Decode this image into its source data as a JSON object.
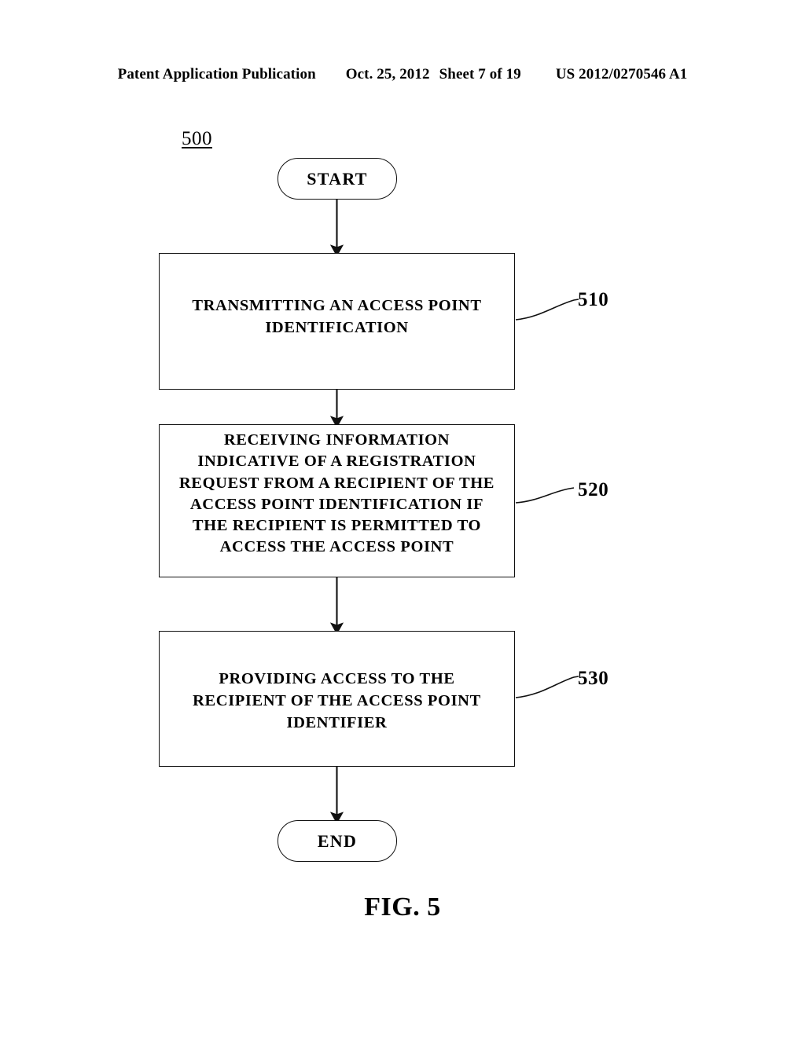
{
  "header": {
    "publication": "Patent Application Publication",
    "date": "Oct. 25, 2012",
    "sheet": "Sheet 7 of 19",
    "patent_number": "US 2012/0270546 A1"
  },
  "figure": {
    "diagram_reference": "500",
    "caption": "FIG. 5",
    "type": "flowchart",
    "nodes": [
      {
        "id": "start",
        "shape": "rounded-terminator",
        "label": "START"
      },
      {
        "id": "510",
        "shape": "rectangle",
        "reference_numeral": "510",
        "label": "TRANSMITTING AN ACCESS POINT IDENTIFICATION"
      },
      {
        "id": "520",
        "shape": "rectangle",
        "reference_numeral": "520",
        "label": "RECEIVING INFORMATION INDICATIVE OF A REGISTRATION REQUEST FROM A RECIPIENT OF THE ACCESS POINT IDENTIFICATION IF THE RECIPIENT IS PERMITTED TO ACCESS THE ACCESS POINT"
      },
      {
        "id": "530",
        "shape": "rectangle",
        "reference_numeral": "530",
        "label": "PROVIDING ACCESS TO THE RECIPIENT OF THE ACCESS POINT IDENTIFIER"
      },
      {
        "id": "end",
        "shape": "rounded-terminator",
        "label": "END"
      }
    ],
    "edges": [
      {
        "from": "start",
        "to": "510",
        "style": "solid-arrow"
      },
      {
        "from": "510",
        "to": "520",
        "style": "solid-arrow"
      },
      {
        "from": "520",
        "to": "530",
        "style": "solid-arrow"
      },
      {
        "from": "530",
        "to": "end",
        "style": "solid-arrow"
      }
    ],
    "colors": {
      "line": "#111111",
      "text": "#000000",
      "background": "#ffffff"
    }
  }
}
